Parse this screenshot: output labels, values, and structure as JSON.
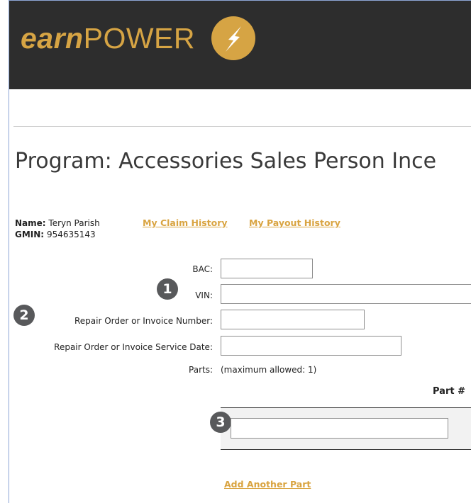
{
  "header": {
    "logo_earn": "earn",
    "logo_power": "POWER",
    "brand_color": "#d6a444",
    "background": "#2d2d2d"
  },
  "page_title": "Program: Accessories Sales Person Ince",
  "user": {
    "name_label": "Name:",
    "name_value": "Teryn Parish",
    "gmin_label": "GMIN:",
    "gmin_value": "954635143"
  },
  "links": {
    "claim_history": "My Claim History",
    "payout_history": "My Payout History",
    "add_part": "Add Another Part"
  },
  "form": {
    "bac_label": "BAC:",
    "bac_value": "",
    "vin_label": "VIN:",
    "vin_value": "",
    "ro_number_label": "Repair Order or Invoice Number:",
    "ro_number_value": "",
    "ro_date_label": "Repair Order or Invoice Service Date:",
    "ro_date_value": "",
    "parts_label": "Parts:",
    "parts_note": "(maximum allowed: 1)",
    "part_column_header": "Part #",
    "part_value": ""
  },
  "badges": [
    "1",
    "2",
    "3"
  ],
  "icons": {
    "logo_mark": "lightning-bolt-icon"
  }
}
